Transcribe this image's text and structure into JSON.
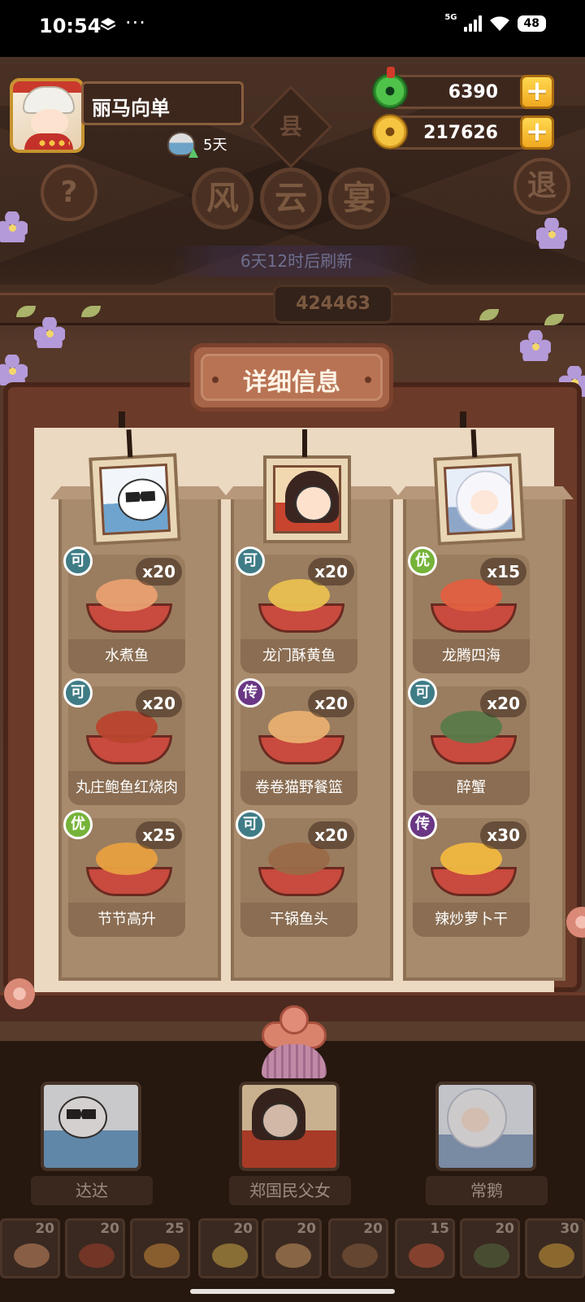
{
  "status_bar": {
    "time": "10:54",
    "dots": "···",
    "network": "5G",
    "battery": "48"
  },
  "player": {
    "name": "丽马向单",
    "days": "5天"
  },
  "county_char": "县",
  "currency": {
    "jade": "6390",
    "gold": "217626"
  },
  "buttons": {
    "help": "?",
    "exit": "退",
    "plus": "+"
  },
  "title_chars": [
    "风",
    "云",
    "宴"
  ],
  "refresh_text": "6天12时后刷新",
  "score": "424463",
  "detail_label": "详细信息",
  "columns": [
    {
      "chef": "达达",
      "dishes": [
        {
          "name": "水煮鱼",
          "count": "x20",
          "grade": "可",
          "food": "#e8a070"
        },
        {
          "name": "丸庄鲍鱼红烧肉",
          "count": "x20",
          "grade": "可",
          "food": "#b8442e"
        },
        {
          "name": "节节高升",
          "count": "x25",
          "grade": "优",
          "food": "#e8a040"
        }
      ]
    },
    {
      "chef": "郑国民父女",
      "dishes": [
        {
          "name": "龙门酥黄鱼",
          "count": "x20",
          "grade": "可",
          "food": "#e8c050"
        },
        {
          "name": "卷卷猫野餐篮",
          "count": "x20",
          "grade": "传",
          "food": "#e8b070"
        },
        {
          "name": "干锅鱼头",
          "count": "x20",
          "grade": "可",
          "food": "#9a6a48"
        }
      ]
    },
    {
      "chef": "常鹅",
      "dishes": [
        {
          "name": "龙腾四海",
          "count": "x15",
          "grade": "优",
          "food": "#e06040"
        },
        {
          "name": "醉蟹",
          "count": "x20",
          "grade": "可",
          "food": "#5a7a4a"
        },
        {
          "name": "辣炒萝卜干",
          "count": "x30",
          "grade": "传",
          "food": "#f0b840"
        }
      ]
    }
  ],
  "bottom_slots": [
    {
      "count": "20",
      "food": "#e8a070"
    },
    {
      "count": "20",
      "food": "#b8442e"
    },
    {
      "count": "25",
      "food": "#e8a040"
    },
    {
      "count": "20",
      "food": "#e8c050"
    },
    {
      "count": "20",
      "food": "#e8b070"
    },
    {
      "count": "20",
      "food": "#9a6a48"
    },
    {
      "count": "15",
      "food": "#e06040"
    },
    {
      "count": "20",
      "food": "#5a7a4a"
    },
    {
      "count": "30",
      "food": "#f0b840"
    }
  ]
}
